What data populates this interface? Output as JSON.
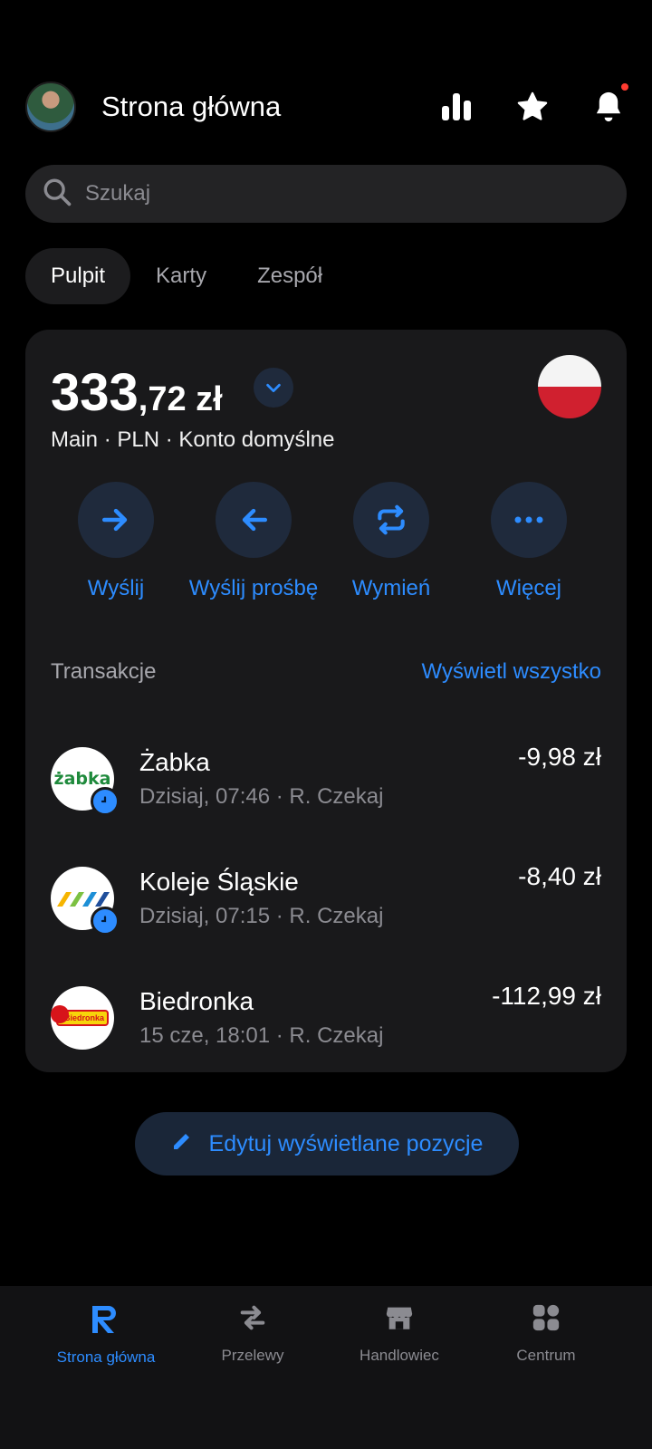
{
  "header": {
    "title": "Strona główna",
    "icons": [
      "analytics-icon",
      "star-icon",
      "bell-icon"
    ]
  },
  "search": {
    "placeholder": "Szukaj"
  },
  "tabs": [
    {
      "label": "Pulpit",
      "active": true
    },
    {
      "label": "Karty",
      "active": false
    },
    {
      "label": "Zespół",
      "active": false
    }
  ],
  "account": {
    "balance_main": "333",
    "balance_dec": ",72 zł",
    "details": "Main · PLN · Konto domyślne",
    "flag": "poland-flag"
  },
  "actions": [
    {
      "label": "Wyślij",
      "icon": "arrow-right-icon"
    },
    {
      "label": "Wyślij prośbę",
      "icon": "arrow-left-icon"
    },
    {
      "label": "Wymień",
      "icon": "exchange-icon"
    },
    {
      "label": "Więcej",
      "icon": "more-icon"
    }
  ],
  "transactions": {
    "title": "Transakcje",
    "view_all": "Wyświetl wszystko",
    "items": [
      {
        "name": "Żabka",
        "sub": "Dzisiaj, 07:46 · R. Czekaj",
        "amount": "-9,98 zł",
        "logo_text": "żabka",
        "pending": true
      },
      {
        "name": "Koleje Śląskie",
        "sub": "Dzisiaj, 07:15 · R. Czekaj",
        "amount": "-8,40 zł",
        "logo_text": "",
        "pending": true
      },
      {
        "name": "Biedronka",
        "sub": "15 cze, 18:01 · R. Czekaj",
        "amount": "-112,99 zł",
        "logo_text": "Biedronka",
        "pending": false
      }
    ]
  },
  "edit_button": {
    "label": "Edytuj wyświetlane pozycje"
  },
  "bottom_nav": [
    {
      "label": "Strona główna",
      "icon": "revolut-r-icon",
      "active": true
    },
    {
      "label": "Przelewy",
      "icon": "transfer-icon",
      "active": false
    },
    {
      "label": "Handlowiec",
      "icon": "store-icon",
      "active": false
    },
    {
      "label": "Centrum",
      "icon": "grid-icon",
      "active": false
    }
  ],
  "colors": {
    "accent": "#2d8cff",
    "card": "#19191b",
    "notification": "#ff3b30"
  }
}
